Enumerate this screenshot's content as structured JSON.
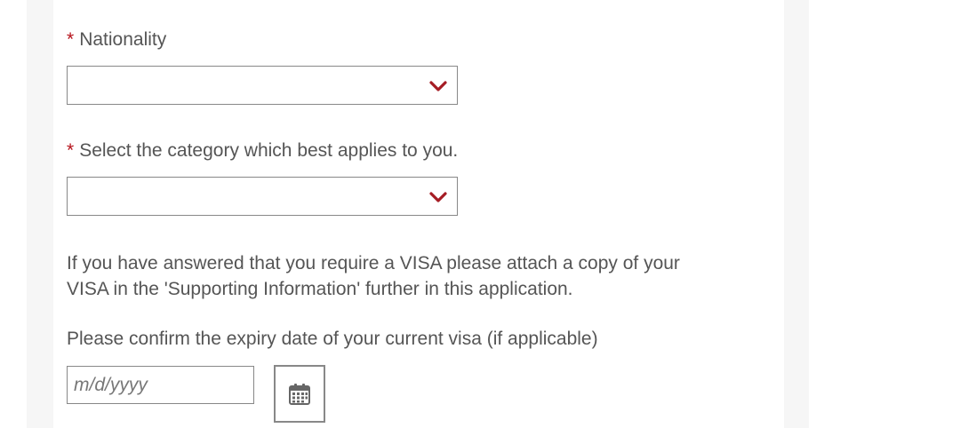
{
  "form": {
    "required_marker": "*",
    "nationality": {
      "label": "Nationality",
      "value": ""
    },
    "category": {
      "label": "Select the category which best applies to you.",
      "value": ""
    },
    "visa_note": {
      "line1": "If you have answered that you require a VISA please attach a copy of your",
      "line2": "VISA in the 'Supporting Information' further in this application."
    },
    "visa_expiry": {
      "label": "Please confirm the expiry date of your current visa (if applicable)",
      "placeholder": "m/d/yyyy",
      "value": ""
    }
  },
  "icons": {
    "dropdown": "chevron-down-icon",
    "calendar": "calendar-icon"
  },
  "colors": {
    "required": "#b5121b",
    "chevron": "#a51c24",
    "text": "#555555",
    "border": "#888888"
  }
}
